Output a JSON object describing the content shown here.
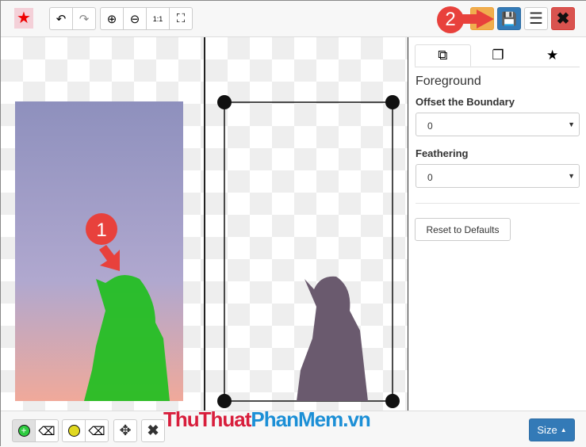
{
  "toolbar": {
    "icons": [
      "app-logo",
      "undo-icon",
      "redo-icon",
      "zoom-in-icon",
      "zoom-out-icon",
      "zoom-actual-icon",
      "zoom-fit-icon",
      "play-icon",
      "save-icon",
      "menu-icon",
      "close-icon"
    ],
    "zoom_actual_label": "1:1"
  },
  "annotations": {
    "step1": "1",
    "step2": "2"
  },
  "panel": {
    "tabs": [
      "foreground-icon",
      "background-icon",
      "star-icon"
    ],
    "title": "Foreground",
    "offset_label": "Offset the Boundary",
    "offset_value": "0",
    "feather_label": "Feathering",
    "feather_value": "0",
    "reset_label": "Reset to Defaults"
  },
  "bottom": {
    "watermark_a": "ThuThuat",
    "watermark_b": "PhanMem",
    "watermark_c": ".vn",
    "size_label": "Size"
  },
  "colors": {
    "save": "#337ab7",
    "play": "#f0ad4e",
    "close": "#d9534f",
    "annotation": "#e8413c",
    "mask": "#1fbf1f"
  }
}
